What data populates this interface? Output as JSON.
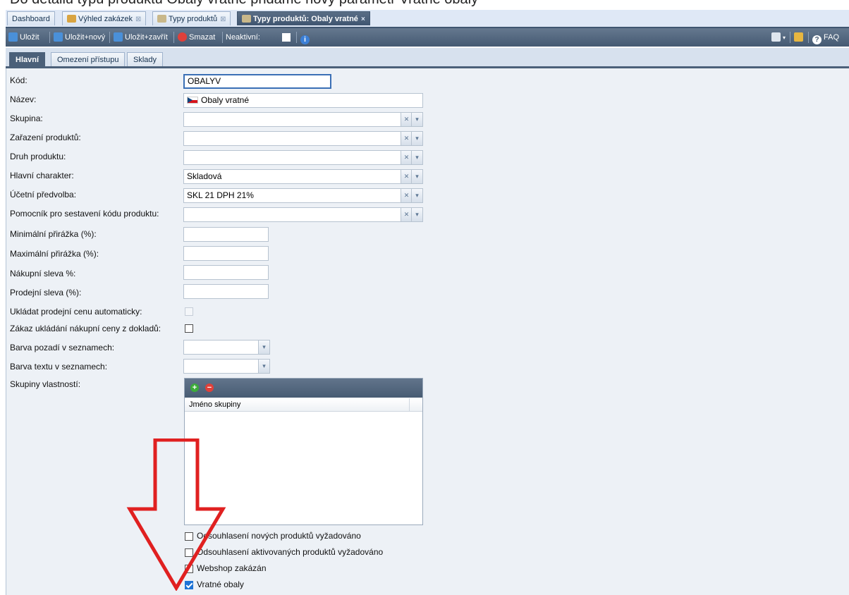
{
  "caption": "Do detailu typu produktu Obaly vratné přidáme nový parametr Vratné obaly",
  "tabs": [
    {
      "label": "Dashboard"
    },
    {
      "label": "Výhled zakázek"
    },
    {
      "label": "Typy produktů"
    },
    {
      "label": "Typy produktů: Obaly vratné"
    }
  ],
  "toolbar": {
    "save": "Uložit",
    "save_new": "Uložit+nový",
    "save_close": "Uložit+zavřít",
    "delete": "Smazat",
    "inactive": "Neaktivní:",
    "faq": "FAQ"
  },
  "subtabs": [
    {
      "label": "Hlavní"
    },
    {
      "label": "Omezení přístupu"
    },
    {
      "label": "Sklady"
    }
  ],
  "form": {
    "kod_label": "Kód:",
    "kod_value": "OBALYV",
    "nazev_label": "Název:",
    "nazev_value": "Obaly vratné",
    "skupina_label": "Skupina:",
    "zarazeni_label": "Zařazení produktů:",
    "druh_label": "Druh produktu:",
    "charakter_label": "Hlavní charakter:",
    "charakter_value": "Skladová",
    "predvolba_label": "Účetní předvolba:",
    "predvolba_value": "SKL 21 DPH 21%",
    "pomocnik_label": "Pomocník pro sestavení kódu produktu:",
    "min_prirazka_label": "Minimální přirážka (%):",
    "max_prirazka_label": "Maximální přirážka (%):",
    "nakupni_sleva_label": "Nákupní sleva %:",
    "prodejni_sleva_label": "Prodejní sleva (%):",
    "ukladat_label": "Ukládat prodejní cenu automaticky:",
    "zakaz_label": "Zákaz ukládání nákupní ceny z dokladů:",
    "barva_pozadi_label": "Barva pozadí v seznamech:",
    "barva_textu_label": "Barva textu v seznamech:",
    "skupiny_label": "Skupiny vlastností:"
  },
  "grid": {
    "column": "Jméno skupiny"
  },
  "checkboxes": {
    "odsouhlaseni_novych": "Odsouhlasení nových produktů vyžadováno",
    "odsouhlaseni_aktivovanych": "Odsouhlasení aktivovaných produktů vyžadováno",
    "webshop": "Webshop zakázán",
    "vratne_obaly": "Vratné obaly"
  },
  "colors": {
    "accent": "#3f5570",
    "arrow": "#e02020",
    "checked": "#1e73d6"
  }
}
